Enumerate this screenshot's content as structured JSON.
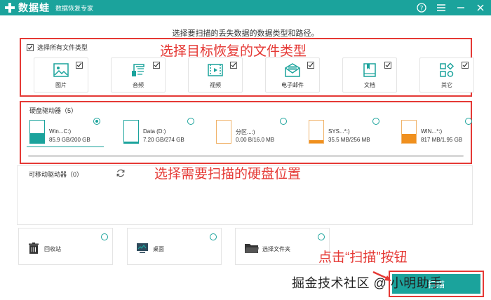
{
  "titlebar": {
    "app_name": "数据蛙",
    "app_subtitle": "数据恢复专家",
    "help_icon": "help-icon",
    "menu_icon": "menu-icon",
    "minimize_icon": "minimize-icon",
    "close_icon": "close-icon",
    "accent": "#1ba39c"
  },
  "prompt": "选择要扫描的丢失数据的数据类型和路径。",
  "file_types": {
    "select_all_label": "选择所有文件类型",
    "select_all_checked": true,
    "annotation": "选择目标恢复的文件类型",
    "items": [
      {
        "label": "图片",
        "icon": "image-icon",
        "checked": true
      },
      {
        "label": "音频",
        "icon": "music-icon",
        "checked": true
      },
      {
        "label": "视频",
        "icon": "video-icon",
        "checked": true
      },
      {
        "label": "电子邮件",
        "icon": "email-icon",
        "checked": true
      },
      {
        "label": "文档",
        "icon": "document-icon",
        "checked": true
      },
      {
        "label": "其它",
        "icon": "other-icon",
        "checked": true
      }
    ]
  },
  "hard_drives": {
    "title": "硬盘驱动器（5）",
    "items": [
      {
        "name": "Win...C:)",
        "size": "85.9 GB/200 GB",
        "used_fraction": 0.43,
        "selected": true
      },
      {
        "name": "Data (D:)",
        "size": "7.20 GB/274 GB",
        "used_fraction": 0.03,
        "selected": false
      },
      {
        "name": "分区...:)",
        "size": "0.00  B/16.0 MB",
        "used_fraction": 0.0,
        "selected": false
      },
      {
        "name": "SYS...*:)",
        "size": "35.5 MB/256 MB",
        "used_fraction": 0.14,
        "selected": false
      },
      {
        "name": "WIN...*:)",
        "size": "817 MB/1.95 GB",
        "used_fraction": 0.41,
        "selected": false
      }
    ]
  },
  "removable": {
    "title": "可移动驱动器（0）",
    "annotation": "选择需要扫描的硬盘位置"
  },
  "locations": [
    {
      "label": "回收站",
      "icon": "trash-icon"
    },
    {
      "label": "桌面",
      "icon": "desktop-icon"
    },
    {
      "label": "选择文件夹",
      "icon": "folder-icon"
    }
  ],
  "scan": {
    "annotation": "点击“扫描”按钮",
    "button_label": "扫描"
  },
  "watermark": "掘金技术社区 @ 小明助手",
  "colors": {
    "teal": "#1ba39c",
    "red_annotation": "#e53935",
    "orange_fill": "#f0901e"
  }
}
